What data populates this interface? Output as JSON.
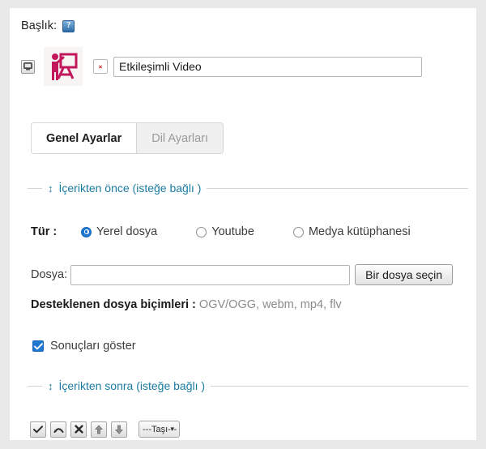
{
  "title_section": {
    "label": "Başlık:",
    "help_icon_glyph": "?",
    "help_icon_name": "help-question-icon",
    "settings_button_name": "screen-settings-icon",
    "remove_button_glyph": "✖",
    "activity_icon_name": "interactive-video-presenter-icon",
    "input_value": "Etkileşimli Video",
    "input_placeholder": ""
  },
  "tabs": [
    {
      "label": "Genel Ayarlar",
      "active": true
    },
    {
      "label": "Dil Ayarları",
      "active": false
    }
  ],
  "before_content": {
    "legend": "İçerikten önce (isteğe bağlı )",
    "drag_handle_glyph": "↕"
  },
  "type_row": {
    "label": "Tür :",
    "options": [
      {
        "label": "Yerel dosya",
        "selected": true
      },
      {
        "label": "Youtube",
        "selected": false
      },
      {
        "label": "Medya kütüphanesi",
        "selected": false
      }
    ]
  },
  "file_row": {
    "label": "Dosya:",
    "value": "",
    "placeholder": "",
    "button_label": "Bir dosya seçin"
  },
  "formats": {
    "label": "Desteklenen dosya biçimleri :",
    "value": "OGV/OGG, webm, mp4, flv"
  },
  "show_results": {
    "label": "Sonuçları göster",
    "checked": true
  },
  "after_content": {
    "legend": "İçerikten sonra (isteğe bağlı )",
    "drag_handle_glyph": "↕"
  },
  "bottom_toolbar": {
    "buttons": [
      {
        "name": "confirm-check-icon"
      },
      {
        "name": "undo-arrow-icon"
      },
      {
        "name": "delete-cross-icon"
      },
      {
        "name": "move-up-arrow-icon"
      },
      {
        "name": "move-down-arrow-icon"
      }
    ],
    "move_select_value": "---Taşı---"
  },
  "colors": {
    "page_background": "#e9e9e9",
    "panel_background": "#ffffff",
    "legend_text": "#1b7ba0",
    "accent_blue": "#1e78cf",
    "activity_icon": "#c2185b",
    "muted_text": "#8b8b8b"
  }
}
